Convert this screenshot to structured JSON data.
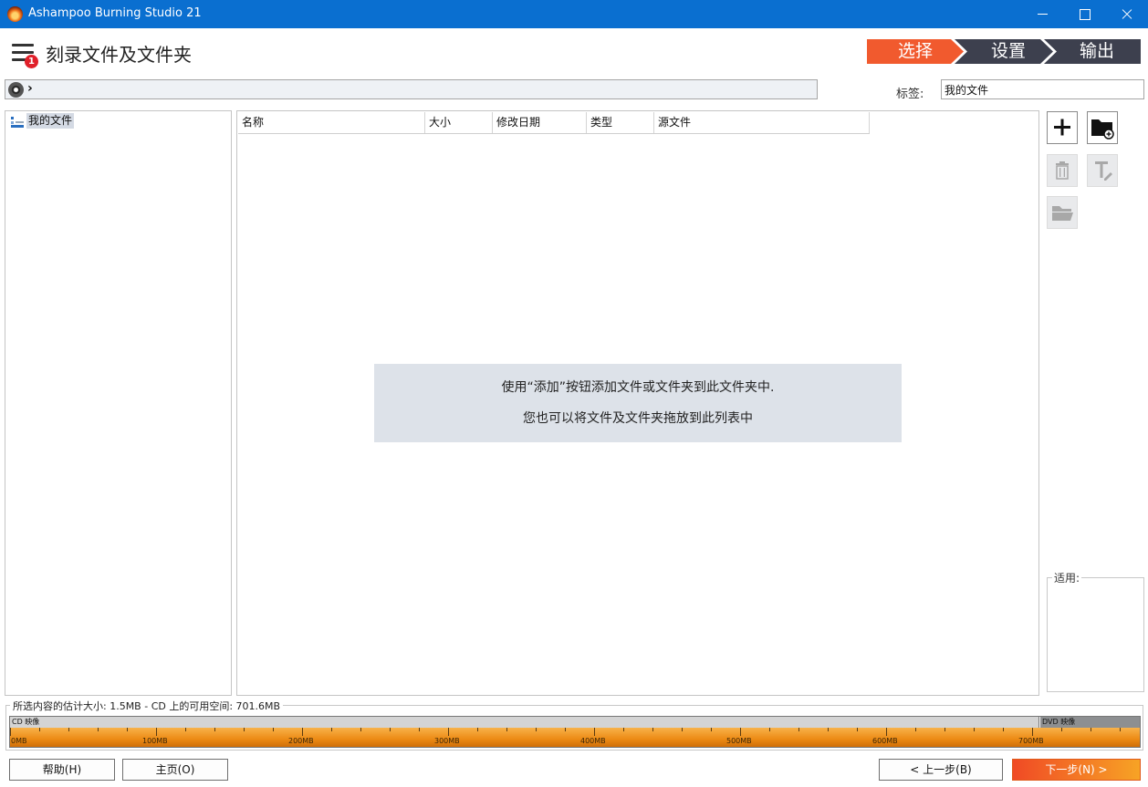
{
  "window": {
    "title": "Ashampoo Burning Studio 21"
  },
  "header": {
    "menu_badge": "1",
    "page_title": "刻录文件及文件夹",
    "steps": [
      "选择",
      "设置",
      "输出"
    ]
  },
  "path_bar": {
    "chevron": "›"
  },
  "label_field": {
    "caption": "标签:",
    "value": "我的文件"
  },
  "tree": {
    "root_label": "我的文件"
  },
  "file_list": {
    "columns": [
      "名称",
      "大小",
      "修改日期",
      "类型",
      "源文件"
    ],
    "hint_line1": "使用“添加”按钮添加文件或文件夹到此文件夹中.",
    "hint_line2": "您也可以将文件及文件夹拖放到此列表中"
  },
  "sidebar": {
    "suitable_label": "适用:"
  },
  "capacity": {
    "summary": "所选内容的估计大小: 1.5MB - CD 上的可用空间: 701.6MB",
    "cd_label": "CD 映像",
    "dvd_label": "DVD 映像",
    "scale_labels": [
      "0MB",
      "100MB",
      "200MB",
      "300MB",
      "400MB",
      "500MB",
      "600MB",
      "700MB"
    ]
  },
  "footer": {
    "help": "帮助(H)",
    "home": "主页(O)",
    "back": "< 上一步(B)",
    "next": "下一步(N) >"
  },
  "colors": {
    "titlebar": "#0a6fd0",
    "step_active": "#f15a2e",
    "step_inactive": "#3d404e",
    "capacity_orange": "#ec8a14"
  },
  "icons": [
    "app-logo-icon",
    "hamburger-menu-icon",
    "disc-icon",
    "tree-folder-icon",
    "plus-icon",
    "folder-add-icon",
    "trash-icon",
    "text-edit-icon",
    "folder-open-icon"
  ]
}
